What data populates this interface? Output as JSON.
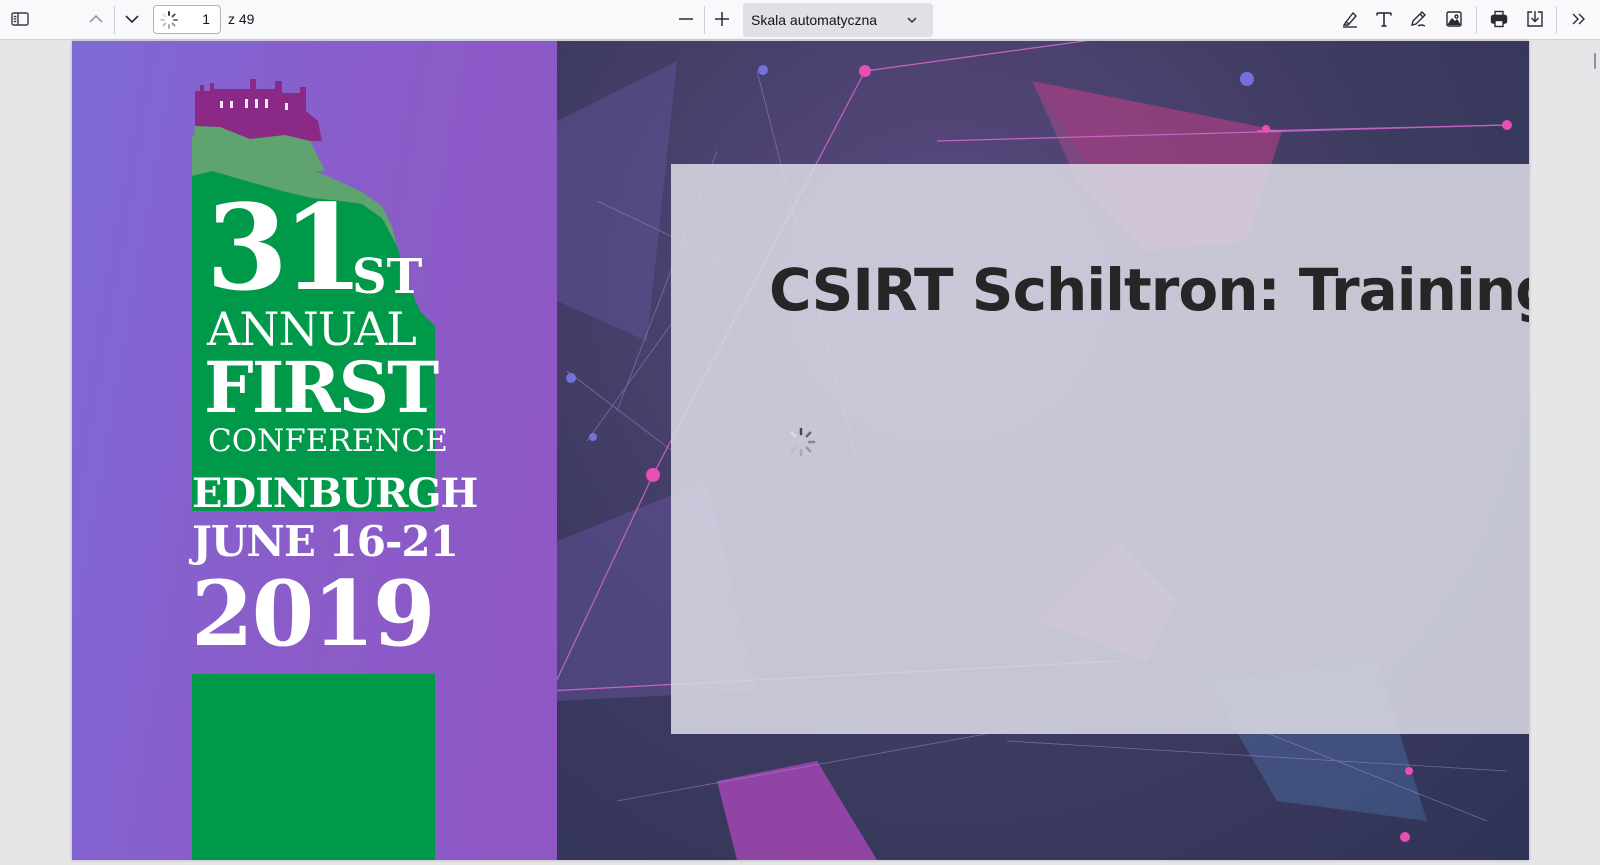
{
  "toolbar": {
    "page_number": "1",
    "page_of": "z 49",
    "scale_label": "Skala automatyczna",
    "icons": [
      "sidebar-toggle-icon",
      "chevron-up-icon",
      "chevron-down-icon",
      "zoom-out-icon",
      "zoom-in-icon",
      "highlight-icon",
      "text-icon",
      "draw-icon",
      "image-icon",
      "print-icon",
      "save-icon",
      "more-tools-icon"
    ]
  },
  "slide": {
    "title": "CSIRT Schiltron: Training,",
    "logo": {
      "number": "31",
      "suffix": "ST",
      "line1": "ANNUAL",
      "line2": "FIRST",
      "line3": "CONFERENCE",
      "city": "EDINBURGH",
      "dates": "JUNE 16-21",
      "year": "2019"
    },
    "colors": {
      "logo_green": "#00994a",
      "left_panel_purple": "#8a5cc9",
      "castle_magenta": "#8b2a86",
      "title_color": "#262626"
    }
  }
}
